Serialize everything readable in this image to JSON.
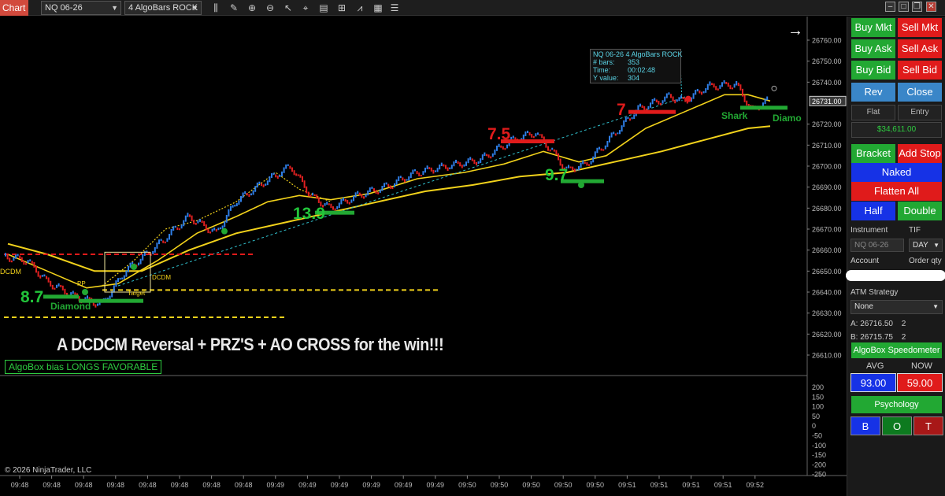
{
  "toolbar": {
    "tab_label": "Chart",
    "instrument": "NQ 06-26",
    "bar_type": "4 AlgoBars ROCK"
  },
  "price_axis": {
    "labels": [
      "26760.00",
      "26750.00",
      "26740.00",
      "26731.00",
      "26720.00",
      "26710.00",
      "26700.00",
      "26690.00",
      "26680.00",
      "26670.00",
      "26660.00",
      "26650.00",
      "26640.00",
      "26630.00",
      "26620.00",
      "26610.00"
    ],
    "current_price": "26731.00"
  },
  "osc_axis": {
    "labels": [
      "200",
      "150",
      "100",
      "50",
      "0",
      "-50",
      "-100",
      "-150",
      "-200",
      "-250"
    ]
  },
  "time_axis": {
    "labels": [
      "09:48",
      "09:48",
      "09:48",
      "09:48",
      "09:48",
      "09:48",
      "09:48",
      "09:48",
      "09:49",
      "09:49",
      "09:49",
      "09:49",
      "09:49",
      "09:49",
      "09:50",
      "09:50",
      "09:50",
      "09:50",
      "09:50",
      "09:51",
      "09:51",
      "09:51",
      "09:51",
      "09:52"
    ]
  },
  "tooltip": {
    "title": "NQ 06-26 4 AlgoBars ROCK",
    "rows": [
      {
        "label": "# bars:",
        "value": "353"
      },
      {
        "label": "Time:",
        "value": "00:02:48"
      },
      {
        "label": "Y value:",
        "value": "304"
      }
    ]
  },
  "annotations": {
    "headline": "A DCDCM Reversal + PRZ'S + AO CROSS for the win!!!",
    "bias_box": "AlgoBox bias LONGS FAVORABLE",
    "copyright": "© 2026 NinjaTrader, LLC",
    "num_8_7": "8.7",
    "num_13_9": "13.9",
    "num_9_7": "9.7",
    "num_7_5": "7.5",
    "num_7": "7",
    "dcdm_left": "DCDM",
    "dcdm_mid": "DCDM",
    "diamond_left": "Diamond",
    "shark": "Shark",
    "diamond_right": "Diamo",
    "target": "Target",
    "pp": "PP"
  },
  "panel": {
    "buy_mkt": "Buy Mkt",
    "sell_mkt": "Sell Mkt",
    "buy_ask": "Buy Ask",
    "sell_ask": "Sell Ask",
    "buy_bid": "Buy Bid",
    "sell_bid": "Sell Bid",
    "rev": "Rev",
    "close": "Close",
    "flat": "Flat",
    "entry": "Entry",
    "pnl": "$34,611.00",
    "bracket": "Bracket",
    "add_stop": "Add Stop",
    "naked": "Naked",
    "flatten_all": "Flatten All",
    "half": "Half",
    "double": "Double",
    "instrument_label": "Instrument",
    "tif_label": "TIF",
    "instrument_value": "NQ 06-26",
    "tif_value": "DAY",
    "account_label": "Account",
    "order_qty_label": "Order qty",
    "atm_label": "ATM Strategy",
    "atm_value": "None",
    "ask_label": "A:",
    "ask_price": "26716.50",
    "ask_qty": "2",
    "bid_label": "B:",
    "bid_price": "26715.75",
    "bid_qty": "2",
    "speedometer": "AlgoBox Speedometer",
    "avg_label": "AVG",
    "now_label": "NOW",
    "avg_value": "93.00",
    "now_value": "59.00",
    "psychology": "Psychology",
    "b": "B",
    "o": "O",
    "t": "T"
  },
  "colors": {
    "up_bar": "#2f7fe8",
    "down_bar": "#e02020",
    "ma": "#f2d21b",
    "buy": "#22a833",
    "sell": "#e01b1b"
  }
}
